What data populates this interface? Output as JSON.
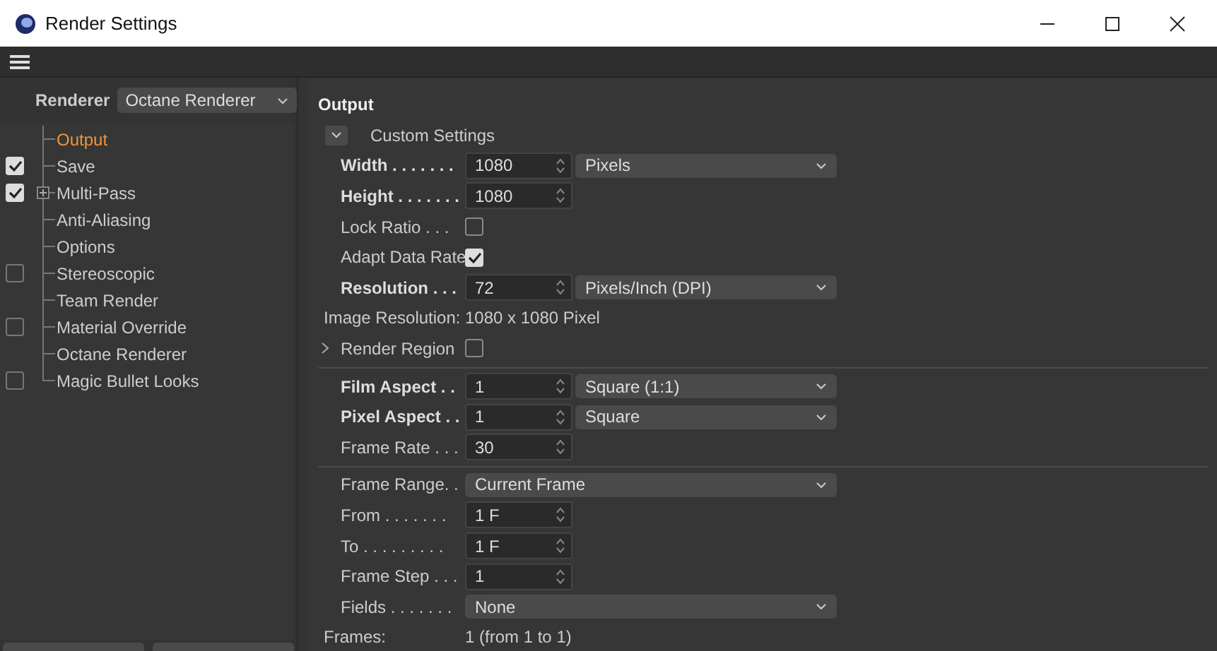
{
  "window": {
    "title": "Render Settings"
  },
  "renderer": {
    "label": "Renderer",
    "value": "Octane Renderer"
  },
  "tree": [
    {
      "label": "Output",
      "kind": "plain",
      "selected": true,
      "expandable": false
    },
    {
      "label": "Save",
      "kind": "check",
      "checked": true,
      "selected": false,
      "expandable": false
    },
    {
      "label": "Multi-Pass",
      "kind": "check",
      "checked": true,
      "selected": false,
      "expandable": true
    },
    {
      "label": "Anti-Aliasing",
      "kind": "plain",
      "selected": false,
      "expandable": false
    },
    {
      "label": "Options",
      "kind": "plain",
      "selected": false,
      "expandable": false
    },
    {
      "label": "Stereoscopic",
      "kind": "check",
      "checked": false,
      "selected": false,
      "expandable": false
    },
    {
      "label": "Team Render",
      "kind": "plain",
      "selected": false,
      "expandable": false
    },
    {
      "label": "Material Override",
      "kind": "check",
      "checked": false,
      "selected": false,
      "expandable": false
    },
    {
      "label": "Octane Renderer",
      "kind": "plain",
      "selected": false,
      "expandable": false
    },
    {
      "label": "Magic Bullet Looks",
      "kind": "check",
      "checked": false,
      "selected": false,
      "expandable": false
    }
  ],
  "panel": {
    "title": "Output",
    "sections": [
      [
        {
          "kind": "preset",
          "label": "Custom Settings"
        },
        {
          "kind": "number",
          "label": "Width . . . . . . .",
          "bold": true,
          "value": "1080",
          "unit": "Pixels"
        },
        {
          "kind": "number",
          "label": "Height . . . . . . .",
          "bold": true,
          "value": "1080"
        },
        {
          "kind": "check",
          "label": "Lock Ratio . . .",
          "bold": false,
          "checked": false
        },
        {
          "kind": "check",
          "label": "Adapt Data Rate",
          "bold": false,
          "checked": true
        },
        {
          "kind": "number",
          "label": "Resolution . . .",
          "bold": true,
          "value": "72",
          "unit": "Pixels/Inch (DPI)"
        },
        {
          "kind": "info",
          "label": "Image Resolution:",
          "value": "1080 x 1080 Pixel"
        },
        {
          "kind": "region",
          "label": "Render Region",
          "checked": false,
          "expanded": false
        }
      ],
      [
        {
          "kind": "number",
          "label": "Film Aspect . .",
          "bold": true,
          "value": "1",
          "unit": "Square (1:1)"
        },
        {
          "kind": "number",
          "label": "Pixel Aspect . .",
          "bold": true,
          "value": "1",
          "unit": "Square"
        },
        {
          "kind": "number",
          "label": "Frame Rate . . .",
          "bold": false,
          "value": "30"
        }
      ],
      [
        {
          "kind": "dropdown",
          "label": "Frame Range. .",
          "value": "Current Frame"
        },
        {
          "kind": "number",
          "label": "From . . . . . . .",
          "bold": false,
          "value": "1 F"
        },
        {
          "kind": "number",
          "label": "To . . . . . . . . .",
          "bold": false,
          "value": "1 F"
        },
        {
          "kind": "number",
          "label": "Frame Step . . .",
          "bold": false,
          "value": "1"
        },
        {
          "kind": "dropdown",
          "label": "Fields . . . . . . .",
          "value": "None"
        },
        {
          "kind": "info",
          "label": "Frames:",
          "value": "1 (from 1 to 1)"
        }
      ]
    ]
  }
}
